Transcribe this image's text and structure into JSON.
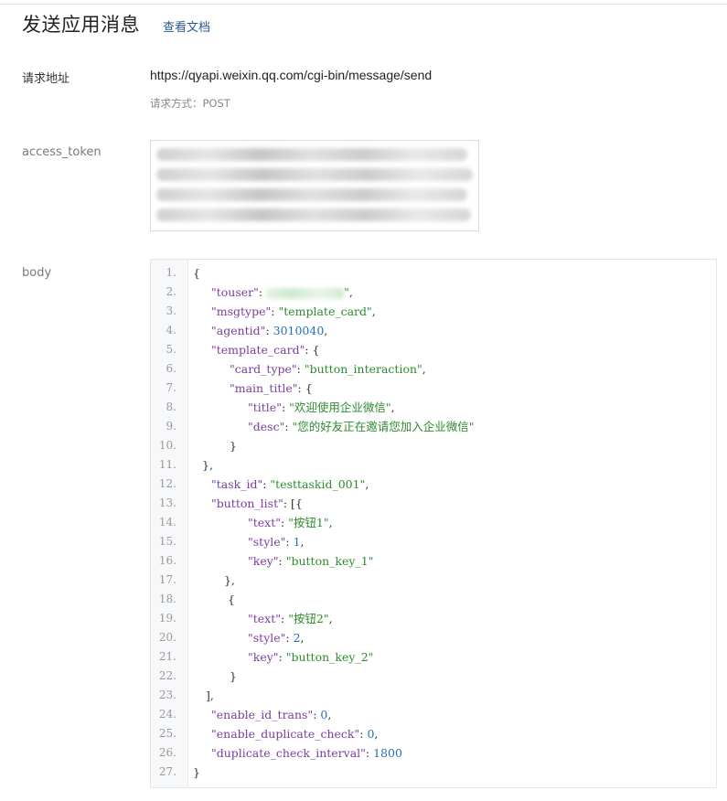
{
  "header": {
    "title": "发送应用消息",
    "doc_link": "查看文档"
  },
  "request": {
    "url_label": "请求地址",
    "url": "https://qyapi.weixin.qq.com/cgi-bin/message/send",
    "method_text": "请求方式：POST"
  },
  "access_token": {
    "label": "access_token",
    "value_redacted": true
  },
  "body": {
    "label": "body",
    "lines": [
      {
        "n": "1.",
        "indent": 0,
        "tokens": [
          {
            "t": "p",
            "v": "{"
          }
        ]
      },
      {
        "n": "2.",
        "indent": 2,
        "tokens": [
          {
            "t": "k",
            "v": "\"touser\""
          },
          {
            "t": "p",
            "v": ": "
          },
          {
            "t": "redacted"
          },
          {
            "t": "s",
            "v": "\""
          },
          {
            "t": "p",
            "v": ","
          }
        ]
      },
      {
        "n": "3.",
        "indent": 2,
        "tokens": [
          {
            "t": "k",
            "v": "\"msgtype\""
          },
          {
            "t": "p",
            "v": ": "
          },
          {
            "t": "s",
            "v": "\"template_card\""
          },
          {
            "t": "p",
            "v": ","
          }
        ]
      },
      {
        "n": "4.",
        "indent": 2,
        "tokens": [
          {
            "t": "k",
            "v": "\"agentid\""
          },
          {
            "t": "p",
            "v": ": "
          },
          {
            "t": "n",
            "v": "3010040"
          },
          {
            "t": "p",
            "v": ","
          }
        ]
      },
      {
        "n": "5.",
        "indent": 2,
        "tokens": [
          {
            "t": "k",
            "v": "\"template_card\""
          },
          {
            "t": "p",
            "v": ": {"
          }
        ]
      },
      {
        "n": "6.",
        "indent": 4,
        "tokens": [
          {
            "t": "k",
            "v": "\"card_type\""
          },
          {
            "t": "p",
            "v": ": "
          },
          {
            "t": "s",
            "v": "\"button_interaction\""
          },
          {
            "t": "p",
            "v": ","
          }
        ]
      },
      {
        "n": "7.",
        "indent": 4,
        "tokens": [
          {
            "t": "k",
            "v": "\"main_title\""
          },
          {
            "t": "p",
            "v": ": {"
          }
        ]
      },
      {
        "n": "8.",
        "indent": 6,
        "tokens": [
          {
            "t": "k",
            "v": "\"title\""
          },
          {
            "t": "p",
            "v": ": "
          },
          {
            "t": "s",
            "v": "\"欢迎使用企业微信\""
          },
          {
            "t": "p",
            "v": ","
          }
        ]
      },
      {
        "n": "9.",
        "indent": 6,
        "tokens": [
          {
            "t": "k",
            "v": "\"desc\""
          },
          {
            "t": "p",
            "v": ": "
          },
          {
            "t": "s",
            "v": "\"您的好友正在邀请您加入企业微信\""
          }
        ]
      },
      {
        "n": "10.",
        "indent": 4,
        "tokens": [
          {
            "t": "p",
            "v": "}"
          }
        ]
      },
      {
        "n": "11.",
        "indent": 1,
        "tokens": [
          {
            "t": "p",
            "v": "},"
          }
        ]
      },
      {
        "n": "12.",
        "indent": 2,
        "tokens": [
          {
            "t": "k",
            "v": "\"task_id\""
          },
          {
            "t": "p",
            "v": ": "
          },
          {
            "t": "s",
            "v": "\"testtaskid_001\""
          },
          {
            "t": "p",
            "v": ","
          }
        ]
      },
      {
        "n": "13.",
        "indent": 2,
        "tokens": [
          {
            "t": "k",
            "v": "\"button_list\""
          },
          {
            "t": "p",
            "v": ": [{"
          }
        ]
      },
      {
        "n": "14.",
        "indent": 6,
        "tokens": [
          {
            "t": "k",
            "v": "\"text\""
          },
          {
            "t": "p",
            "v": ": "
          },
          {
            "t": "s",
            "v": "\"按钮1\""
          },
          {
            "t": "p",
            "v": ","
          }
        ]
      },
      {
        "n": "15.",
        "indent": 6,
        "tokens": [
          {
            "t": "k",
            "v": "\"style\""
          },
          {
            "t": "p",
            "v": ": "
          },
          {
            "t": "n",
            "v": "1"
          },
          {
            "t": "p",
            "v": ","
          }
        ]
      },
      {
        "n": "16.",
        "indent": 6,
        "tokens": [
          {
            "t": "k",
            "v": "\"key\""
          },
          {
            "t": "p",
            "v": ": "
          },
          {
            "t": "s",
            "v": "\"button_key_1\""
          }
        ]
      },
      {
        "n": "17.",
        "indent": 3,
        "tokens": [
          {
            "t": "p",
            "v": " },"
          }
        ]
      },
      {
        "n": "18.",
        "indent": 3,
        "tokens": [
          {
            "t": "p",
            "v": "  {"
          }
        ]
      },
      {
        "n": "19.",
        "indent": 6,
        "tokens": [
          {
            "t": "k",
            "v": "\"text\""
          },
          {
            "t": "p",
            "v": ": "
          },
          {
            "t": "s",
            "v": "\"按钮2\""
          },
          {
            "t": "p",
            "v": ","
          }
        ]
      },
      {
        "n": "20.",
        "indent": 6,
        "tokens": [
          {
            "t": "k",
            "v": "\"style\""
          },
          {
            "t": "p",
            "v": ": "
          },
          {
            "t": "n",
            "v": "2"
          },
          {
            "t": "p",
            "v": ","
          }
        ]
      },
      {
        "n": "21.",
        "indent": 6,
        "tokens": [
          {
            "t": "k",
            "v": "\"key\""
          },
          {
            "t": "p",
            "v": ": "
          },
          {
            "t": "s",
            "v": "\"button_key_2\""
          }
        ]
      },
      {
        "n": "22.",
        "indent": 4,
        "tokens": [
          {
            "t": "p",
            "v": "}"
          }
        ]
      },
      {
        "n": "23.",
        "indent": 1,
        "tokens": [
          {
            "t": "p",
            "v": " ],"
          }
        ]
      },
      {
        "n": "24.",
        "indent": 2,
        "tokens": [
          {
            "t": "k",
            "v": "\"enable_id_trans\""
          },
          {
            "t": "p",
            "v": ": "
          },
          {
            "t": "n",
            "v": "0"
          },
          {
            "t": "p",
            "v": ","
          }
        ]
      },
      {
        "n": "25.",
        "indent": 2,
        "tokens": [
          {
            "t": "k",
            "v": "\"enable_duplicate_check\""
          },
          {
            "t": "p",
            "v": ": "
          },
          {
            "t": "n",
            "v": "0"
          },
          {
            "t": "p",
            "v": ","
          }
        ]
      },
      {
        "n": "26.",
        "indent": 2,
        "tokens": [
          {
            "t": "k",
            "v": "\"duplicate_check_interval\""
          },
          {
            "t": "p",
            "v": ": "
          },
          {
            "t": "n",
            "v": "1800"
          }
        ]
      },
      {
        "n": "27.",
        "indent": 0,
        "tokens": [
          {
            "t": "p",
            "v": "}"
          }
        ]
      }
    ]
  },
  "colors": {
    "key": "#7a3e9d",
    "string": "#2e8b2e",
    "number": "#1f6fbf",
    "link": "#2b5a93"
  }
}
